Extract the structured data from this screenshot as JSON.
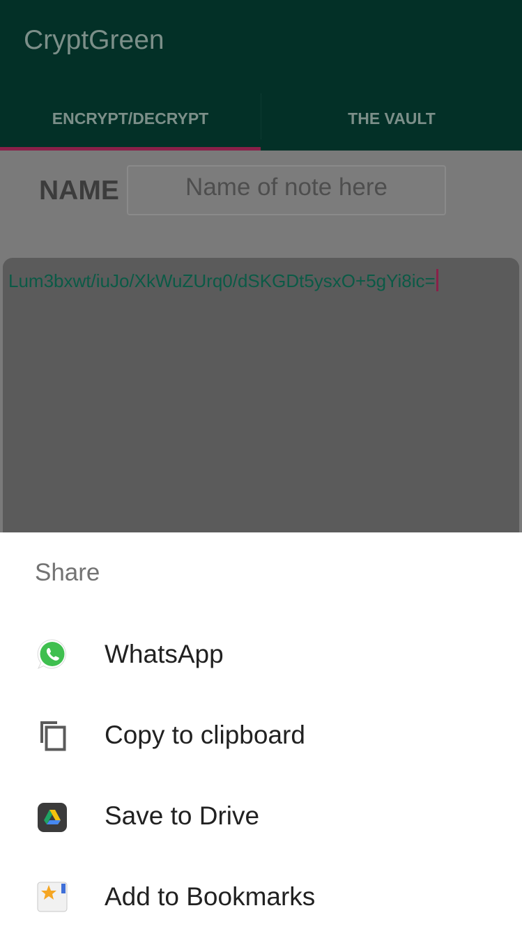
{
  "app": {
    "title": "CryptGreen",
    "tabs": [
      {
        "label": "ENCRYPT/DECRYPT",
        "selected": true
      },
      {
        "label": "THE VAULT",
        "selected": false
      }
    ],
    "name_label": "NAME",
    "name_placeholder": "Name of note here",
    "note_text": "Lum3bxwt/iuJo/XkWuZUrq0/dSKGDt5ysxO+5gYi8ic="
  },
  "colors": {
    "toolbar": "#033027",
    "accent": "#8a2049",
    "cipher_text": "#0b5a46"
  },
  "share_sheet": {
    "title": "Share",
    "items": [
      {
        "label": "WhatsApp",
        "icon": "whatsapp-icon"
      },
      {
        "label": "Copy to clipboard",
        "icon": "copy-icon"
      },
      {
        "label": "Save to Drive",
        "icon": "google-drive-icon"
      },
      {
        "label": "Add to Bookmarks",
        "icon": "bookmarks-icon"
      }
    ]
  }
}
